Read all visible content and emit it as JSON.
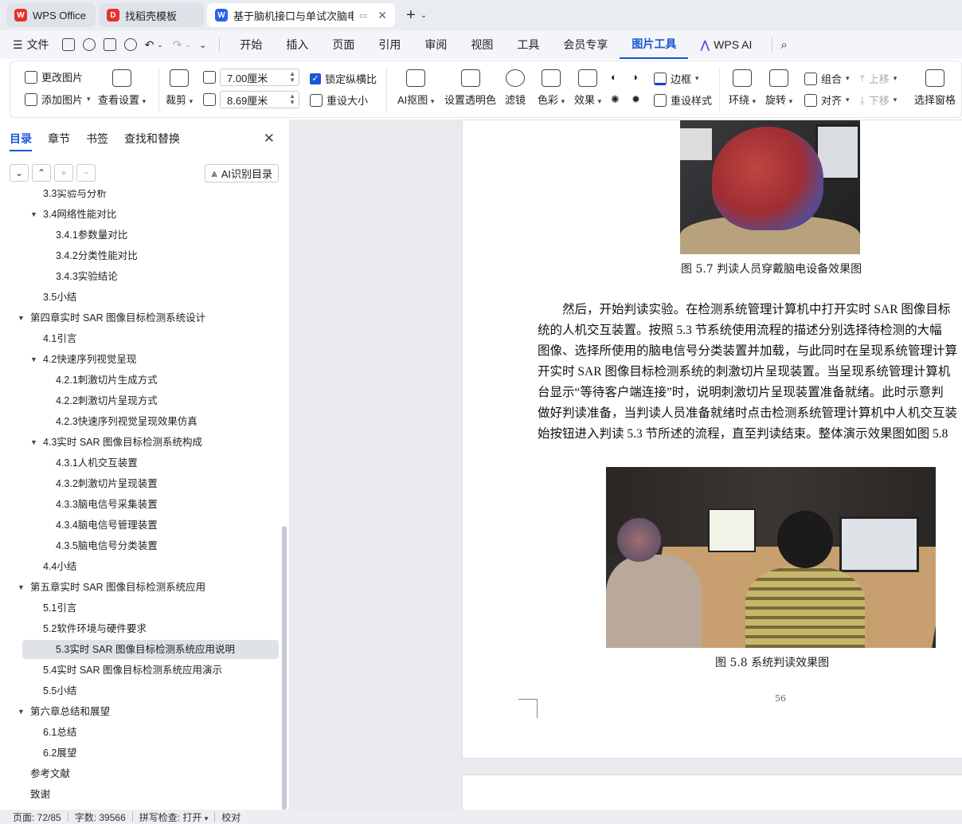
{
  "tabs": [
    {
      "label": "WPS Office",
      "icon": "wps-logo-icon"
    },
    {
      "label": "找稻壳模板",
      "icon": "docer-logo-icon"
    },
    {
      "label": "基于脑机接口与单试次脑电分",
      "icon": "word-doc-icon",
      "active": true
    }
  ],
  "menu": {
    "file": "文件",
    "tabs": [
      "开始",
      "插入",
      "页面",
      "引用",
      "审阅",
      "视图",
      "工具",
      "会员专享",
      "图片工具",
      "WPS AI"
    ],
    "selected_tab": "图片工具"
  },
  "ribbon": {
    "change_image": "更改图片",
    "add_image": "添加图片",
    "view_settings": "查看设置",
    "crop": "裁剪",
    "width_value": "7.00厘米",
    "height_value": "8.69厘米",
    "lock_ratio": "锁定纵横比",
    "reset_size": "重设大小",
    "ai_cutout": "AI抠图",
    "set_transparent": "设置透明色",
    "filter": "滤镜",
    "color": "色彩",
    "effects": "效果",
    "border": "边框",
    "reset_style": "重设样式",
    "wrap": "环绕",
    "rotate": "旋转",
    "group": "组合",
    "align": "对齐",
    "move_up": "上移",
    "move_down": "下移",
    "selection_pane": "选择窗格"
  },
  "sidebar": {
    "tabs": [
      "目录",
      "章节",
      "书签",
      "查找和替换"
    ],
    "ai_toc": "AI识别目录",
    "toc": [
      {
        "label": "3.3实验与分析",
        "level": 2
      },
      {
        "label": "3.4网络性能对比",
        "level": 2,
        "expanded": true
      },
      {
        "label": "3.4.1参数量对比",
        "level": 3
      },
      {
        "label": "3.4.2分类性能对比",
        "level": 3
      },
      {
        "label": "3.4.3实验结论",
        "level": 3
      },
      {
        "label": "3.5小结",
        "level": 2
      },
      {
        "label": "第四章实时 SAR 图像目标检测系统设计",
        "level": 1,
        "expanded": true
      },
      {
        "label": "4.1引言",
        "level": 2
      },
      {
        "label": "4.2快速序列视觉呈现",
        "level": 2,
        "expanded": true
      },
      {
        "label": "4.2.1刺激切片生成方式",
        "level": 3
      },
      {
        "label": "4.2.2刺激切片呈现方式",
        "level": 3
      },
      {
        "label": "4.2.3快速序列视觉呈现效果仿真",
        "level": 3
      },
      {
        "label": "4.3实时 SAR 图像目标检测系统构成",
        "level": 2,
        "expanded": true
      },
      {
        "label": "4.3.1人机交互装置",
        "level": 3
      },
      {
        "label": "4.3.2刺激切片呈现装置",
        "level": 3
      },
      {
        "label": "4.3.3脑电信号采集装置",
        "level": 3
      },
      {
        "label": "4.3.4脑电信号管理装置",
        "level": 3
      },
      {
        "label": "4.3.5脑电信号分类装置",
        "level": 3
      },
      {
        "label": "4.4小结",
        "level": 2
      },
      {
        "label": "第五章实时 SAR 图像目标检测系统应用",
        "level": 1,
        "expanded": true
      },
      {
        "label": "5.1引言",
        "level": 2
      },
      {
        "label": "5.2软件环境与硬件要求",
        "level": 2
      },
      {
        "label": "5.3实时 SAR 图像目标检测系统应用说明",
        "level": 2,
        "selected": true
      },
      {
        "label": "5.4实时 SAR 图像目标检测系统应用演示",
        "level": 2
      },
      {
        "label": "5.5小结",
        "level": 2
      },
      {
        "label": "第六章总结和展望",
        "level": 1,
        "expanded": true
      },
      {
        "label": "6.1总结",
        "level": 2
      },
      {
        "label": "6.2展望",
        "level": 2
      },
      {
        "label": "参考文献",
        "level": 1
      },
      {
        "label": "致谢",
        "level": 1
      }
    ]
  },
  "document": {
    "caption1": "图 5.7 判读人员穿戴脑电设备效果图",
    "paragraph": [
      "然后，开始判读实验。在检测系统管理计算机中打开实时 SAR 图像目标",
      "统的人机交互装置。按照 5.3 节系统使用流程的描述分别选择待检测的大幅",
      "图像、选择所使用的脑电信号分类装置并加载，与此同时在呈现系统管理计算",
      "开实时 SAR 图像目标检测系统的刺激切片呈现装置。当呈现系统管理计算机",
      "台显示“等待客户端连接”时，说明刺激切片呈现装置准备就绪。此时示意判",
      "做好判读准备，当判读人员准备就绪时点击检测系统管理计算机中人机交互装",
      "始按钮进入判读 5.3 节所述的流程，直至判读结束。整体演示效果图如图 5.8"
    ],
    "caption2": "图 5.8 系统判读效果图",
    "page_number": "56"
  },
  "status": {
    "page": "页面: 72/85",
    "words": "字数: 39566",
    "spell": "拼写检查: 打开",
    "proof": "校对"
  }
}
